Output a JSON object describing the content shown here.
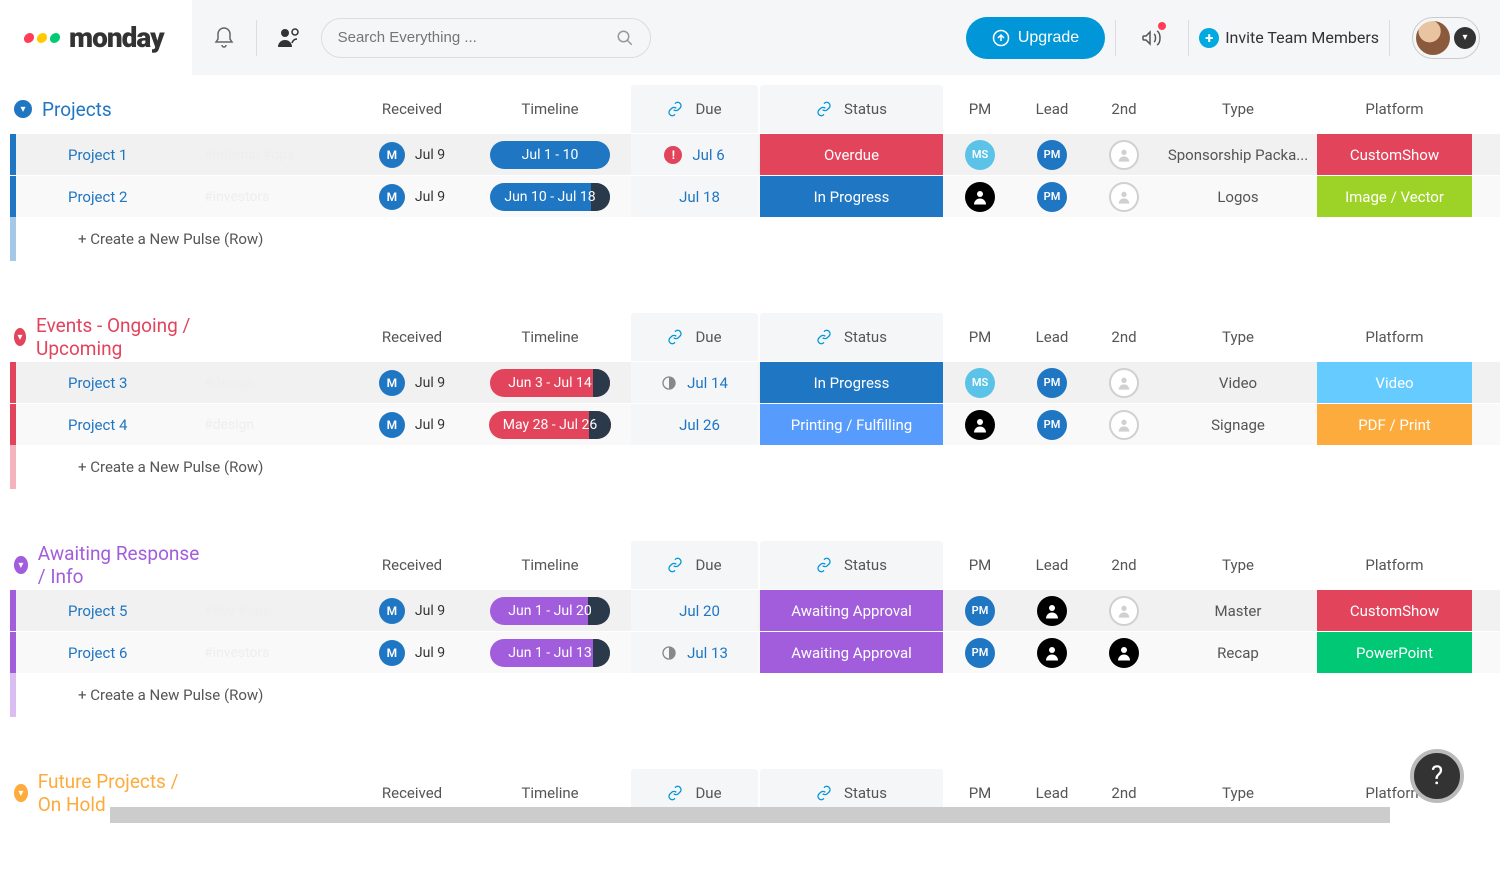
{
  "app": {
    "name": "monday"
  },
  "search": {
    "placeholder": "Search Everything ..."
  },
  "header": {
    "upgrade": "Upgrade",
    "invite": "Invite Team Members"
  },
  "columns": {
    "received": "Received",
    "timeline": "Timeline",
    "due": "Due",
    "status": "Status",
    "pm": "PM",
    "lead": "Lead",
    "second": "2nd",
    "type": "Type",
    "platform": "Platform"
  },
  "new_pulse": "+ Create a New Pulse (Row)",
  "groups": [
    {
      "id": "projects",
      "title": "Projects",
      "color": "#1f76c2",
      "rows": [
        {
          "name": "Project 1",
          "tags": "#internal  #ops",
          "received": "Jul 9",
          "timeline": "Jul 1 - 10",
          "tl_color": "#1f76c2",
          "tl_fill": 0,
          "due": "Jul 6",
          "due_icon": "alert",
          "status": "Overdue",
          "status_color": "#e2445c",
          "pm": {
            "text": "MS",
            "bg": "#5cc3e8"
          },
          "lead": {
            "text": "PM",
            "bg": "#1f76c2"
          },
          "second": {
            "text": "",
            "bg": "#d0d0d0"
          },
          "type": "Sponsorship Packa...",
          "platform": "CustomShow",
          "platform_color": "#e2445c"
        },
        {
          "name": "Project 2",
          "tags": "#investors",
          "received": "Jul 9",
          "timeline": "Jun 10 - Jul 18",
          "tl_color": "#1f76c2",
          "tl_fill": 16,
          "due": "Jul 18",
          "due_icon": "",
          "status": "In Progress",
          "status_color": "#1f76c2",
          "pm": {
            "text": "",
            "bg": "#000"
          },
          "lead": {
            "text": "PM",
            "bg": "#1f76c2"
          },
          "second": {
            "text": "",
            "bg": "#d0d0d0"
          },
          "type": "Logos",
          "platform": "Image / Vector",
          "platform_color": "#9cd326"
        }
      ]
    },
    {
      "id": "events",
      "title": "Events - Ongoing / Upcoming",
      "color": "#e2445c",
      "rows": [
        {
          "name": "Project 3",
          "tags": "#design",
          "received": "Jul 9",
          "timeline": "Jun 3 - Jul 14",
          "tl_color": "#e2445c",
          "tl_fill": 14,
          "due": "Jul 14",
          "due_icon": "half",
          "status": "In Progress",
          "status_color": "#1f76c2",
          "pm": {
            "text": "MS",
            "bg": "#5cc3e8"
          },
          "lead": {
            "text": "PM",
            "bg": "#1f76c2"
          },
          "second": {
            "text": "",
            "bg": "#d0d0d0"
          },
          "type": "Video",
          "platform": "Video",
          "platform_color": "#66ccff"
        },
        {
          "name": "Project 4",
          "tags": "#design",
          "received": "Jul 9",
          "timeline": "May 28 - Jul 26",
          "tl_color": "#e2445c",
          "tl_fill": 18,
          "due": "Jul 26",
          "due_icon": "",
          "status": "Printing / Fulfilling",
          "status_color": "#579bfc",
          "pm": {
            "text": "",
            "bg": "#000"
          },
          "lead": {
            "text": "PM",
            "bg": "#1f76c2"
          },
          "second": {
            "text": "",
            "bg": "#d0d0d0"
          },
          "type": "Signage",
          "platform": "PDF / Print",
          "platform_color": "#fdab3d"
        }
      ]
    },
    {
      "id": "awaiting",
      "title": "Awaiting Response / Info",
      "color": "#a25ddc",
      "rows": [
        {
          "name": "Project 5",
          "tags": "#dev   #ops",
          "received": "Jul 9",
          "timeline": "Jun 1 - Jul 20",
          "tl_color": "#a25ddc",
          "tl_fill": 18,
          "due": "Jul 20",
          "due_icon": "",
          "status": "Awaiting Approval",
          "status_color": "#a25ddc",
          "pm": {
            "text": "PM",
            "bg": "#1f76c2"
          },
          "lead": {
            "text": "",
            "bg": "#000"
          },
          "second": {
            "text": "",
            "bg": "#d0d0d0"
          },
          "type": "Master",
          "platform": "CustomShow",
          "platform_color": "#e2445c"
        },
        {
          "name": "Project 6",
          "tags": "#investors",
          "received": "Jul 9",
          "timeline": "Jun 1 - Jul 13",
          "tl_color": "#a25ddc",
          "tl_fill": 14,
          "due": "Jul 13",
          "due_icon": "half",
          "status": "Awaiting Approval",
          "status_color": "#a25ddc",
          "pm": {
            "text": "PM",
            "bg": "#1f76c2"
          },
          "lead": {
            "text": "",
            "bg": "#000"
          },
          "second": {
            "text": "",
            "bg": "#000"
          },
          "type": "Recap",
          "platform": "PowerPoint",
          "platform_color": "#00c875"
        }
      ]
    },
    {
      "id": "future",
      "title": "Future Projects / On Hold",
      "color": "#fdab3d",
      "rows": []
    }
  ]
}
